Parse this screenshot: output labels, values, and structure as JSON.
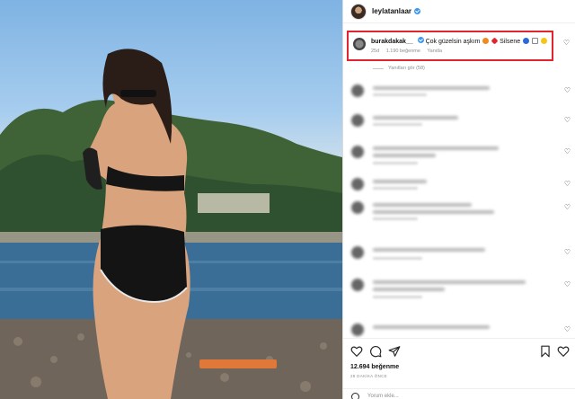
{
  "post": {
    "username": "leylatanlaar",
    "verified": true
  },
  "highlighted_comment": {
    "username": "burakdakak__",
    "text": "Çok güzelsin aşkım",
    "text_tail": "Silsene",
    "emoji_colors": [
      "#f08a1c",
      "#e0262c",
      "#2b6ad6",
      "#f5c518"
    ],
    "age": "25d",
    "likes": "1.190 beğenme",
    "reply": "Yanıtla"
  },
  "replies_label": "Yanıtları gör (58)",
  "actions": {
    "icons": [
      "heart-icon",
      "comment-icon",
      "share-icon",
      "bookmark-icon",
      "save-heart-icon"
    ],
    "likes_count": "12.694 beğenme",
    "timestamp": "28 DAKİKA ÖNCE",
    "comment_placeholder": "Yorum ekle..."
  }
}
